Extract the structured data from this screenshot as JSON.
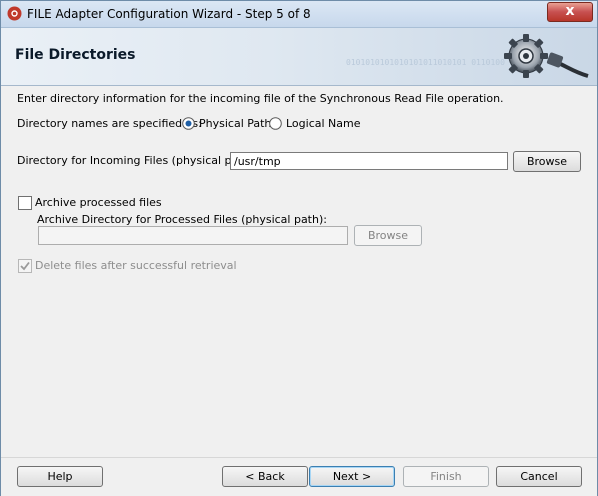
{
  "window": {
    "title": "FILE Adapter Configuration Wizard - Step 5 of 8",
    "close_glyph": "x"
  },
  "header": {
    "title": "File Directories",
    "binary_decoration": "0101010101010101011010101 0110100",
    "icon": "gear-plug-icon"
  },
  "main": {
    "instruction": "Enter directory information for the incoming file of the Synchronous Read File operation.",
    "names_specified_label": "Directory names are specified as:",
    "radio_physical": {
      "label": "Physical Path",
      "selected": true
    },
    "radio_logical": {
      "label": "Logical Name",
      "selected": false
    },
    "incoming_dir_label": "Directory for Incoming Files (physical path):",
    "incoming_dir_value": "/usr/tmp",
    "browse_label": "Browse",
    "archive_checkbox": {
      "label": "Archive processed files",
      "checked": false
    },
    "archive_dir_label": "Archive Directory for Processed Files (physical path):",
    "archive_dir_value": "",
    "archive_browse_label": "Browse",
    "delete_checkbox": {
      "label": "Delete files after successful retrieval",
      "checked": true,
      "enabled": false
    }
  },
  "footer": {
    "help": "Help",
    "back": "< Back",
    "next": "Next >",
    "finish": "Finish",
    "cancel": "Cancel"
  },
  "colors": {
    "accent": "#3c7fb1",
    "close_button": "#c75050"
  }
}
